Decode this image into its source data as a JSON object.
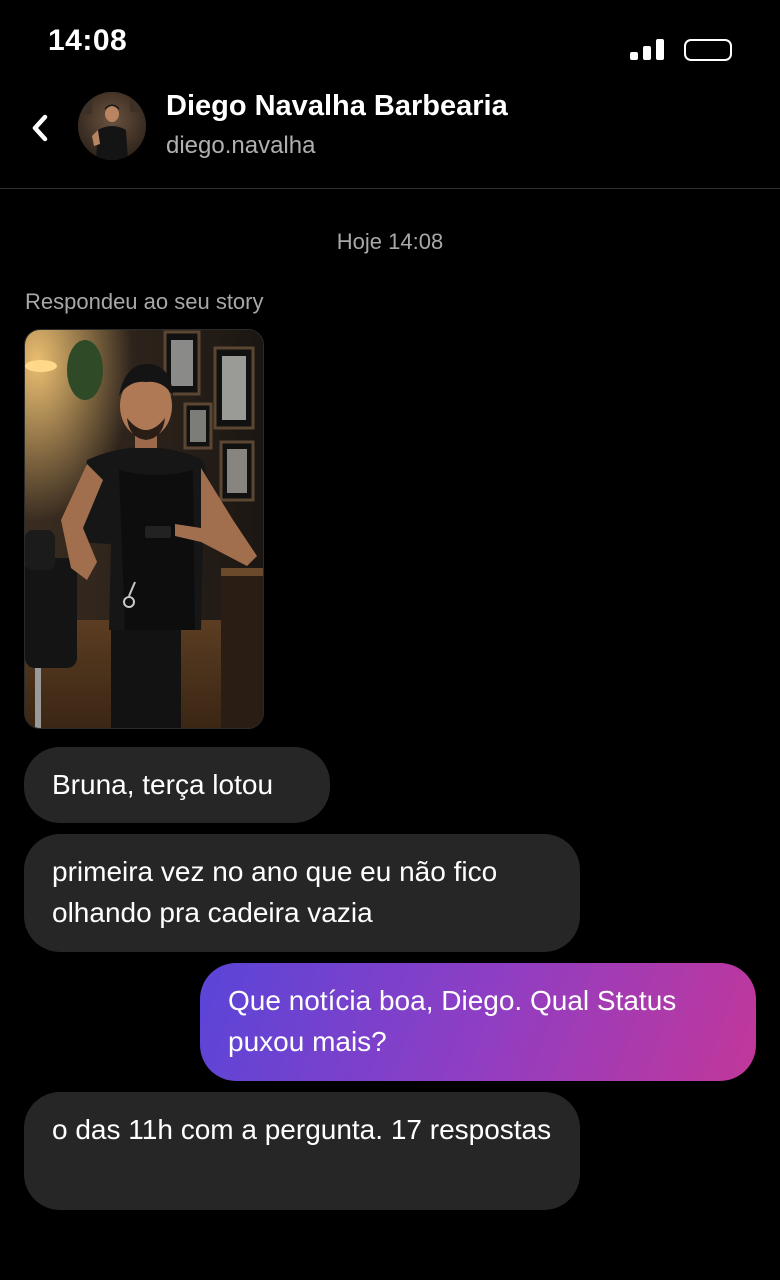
{
  "status_bar": {
    "time": "14:08",
    "icons": [
      "signal-icon",
      "battery-icon"
    ]
  },
  "header": {
    "name": "Diego Navalha Barbearia",
    "handle": "diego.navalha",
    "back_icon": "chevron-left-icon"
  },
  "thread": {
    "timestamp": "Hoje 14:08",
    "story_reply_label": "Respondeu ao seu story",
    "messages": [
      {
        "from": "them",
        "text": "Bruna, terça lotou"
      },
      {
        "from": "them",
        "text": "primeira vez no ano que eu não fico olhando pra cadeira vazia"
      },
      {
        "from": "me",
        "text": "Que notícia boa, Diego. Qual Status puxou mais?"
      },
      {
        "from": "them",
        "text": "o das 11h com a pergunta. 17 respostas"
      }
    ]
  },
  "colors": {
    "background": "#000000",
    "incoming_bubble": "#262626",
    "outgoing_gradient": [
      "#5a45d8",
      "#8e3ec4",
      "#c2379a"
    ],
    "secondary_text": "#a8a8a8"
  }
}
